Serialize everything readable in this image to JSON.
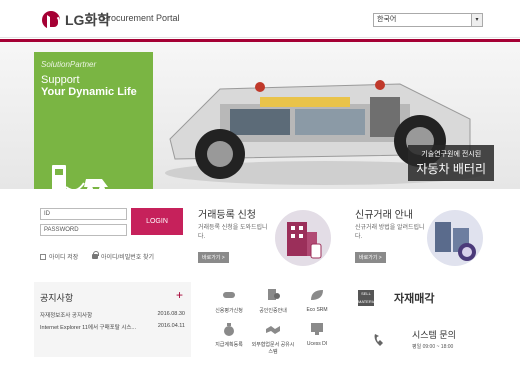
{
  "header": {
    "logo_text": "LG화학",
    "portal_title": "Procurement Portal",
    "language_selected": "한국어"
  },
  "hero": {
    "promo_brand": "SolutionPartner",
    "promo_line1": "Support",
    "promo_line2": "Your Dynamic Life",
    "caption_small": "기술연구원에 전시된",
    "caption_large": "자동차 배터리"
  },
  "login": {
    "id_placeholder": "ID",
    "password_placeholder": "PASSWORD",
    "login_label": "LOGIN",
    "save_id_label": "아이디 저장",
    "find_label": "아이디/비밀번호 찾기"
  },
  "cards": [
    {
      "title": "거래등록 신청",
      "desc": "거래등록 신청을 도와드립니다.",
      "button": "바로가기 >"
    },
    {
      "title": "신규거래 안내",
      "desc": "신규거래 방법을 알려드립니다.",
      "button": "바로가기 >"
    }
  ],
  "notice": {
    "title": "공지사항",
    "plus": "+",
    "items": [
      {
        "text": "자재정보조사 공지사항",
        "date": "2016.08.30"
      },
      {
        "text": "Internet Explorer 11에서 구매포탈 시스...",
        "date": "2016.04.11"
      }
    ]
  },
  "quick_links": [
    {
      "label": "신용평가신청",
      "icon": "pill-icon"
    },
    {
      "label": "공인인증안내",
      "icon": "certificate-icon"
    },
    {
      "label": "Eco SRM",
      "icon": "leaf-icon"
    },
    {
      "label": "지급계획등록",
      "icon": "money-bag-icon"
    },
    {
      "label": "외부협업문서 공유시스템",
      "icon": "handshake-icon"
    },
    {
      "label": "Ucess DI",
      "icon": "monitor-icon"
    }
  ],
  "sell": {
    "icon_text": "SELL MATERIAL",
    "label": "자재매각"
  },
  "contact": {
    "title": "시스템 문의",
    "hours": "평일 09:00 ~ 18:00"
  },
  "colors": {
    "brand": "#a50034",
    "promo_green": "#7ab543",
    "login_button": "#c6215b"
  }
}
